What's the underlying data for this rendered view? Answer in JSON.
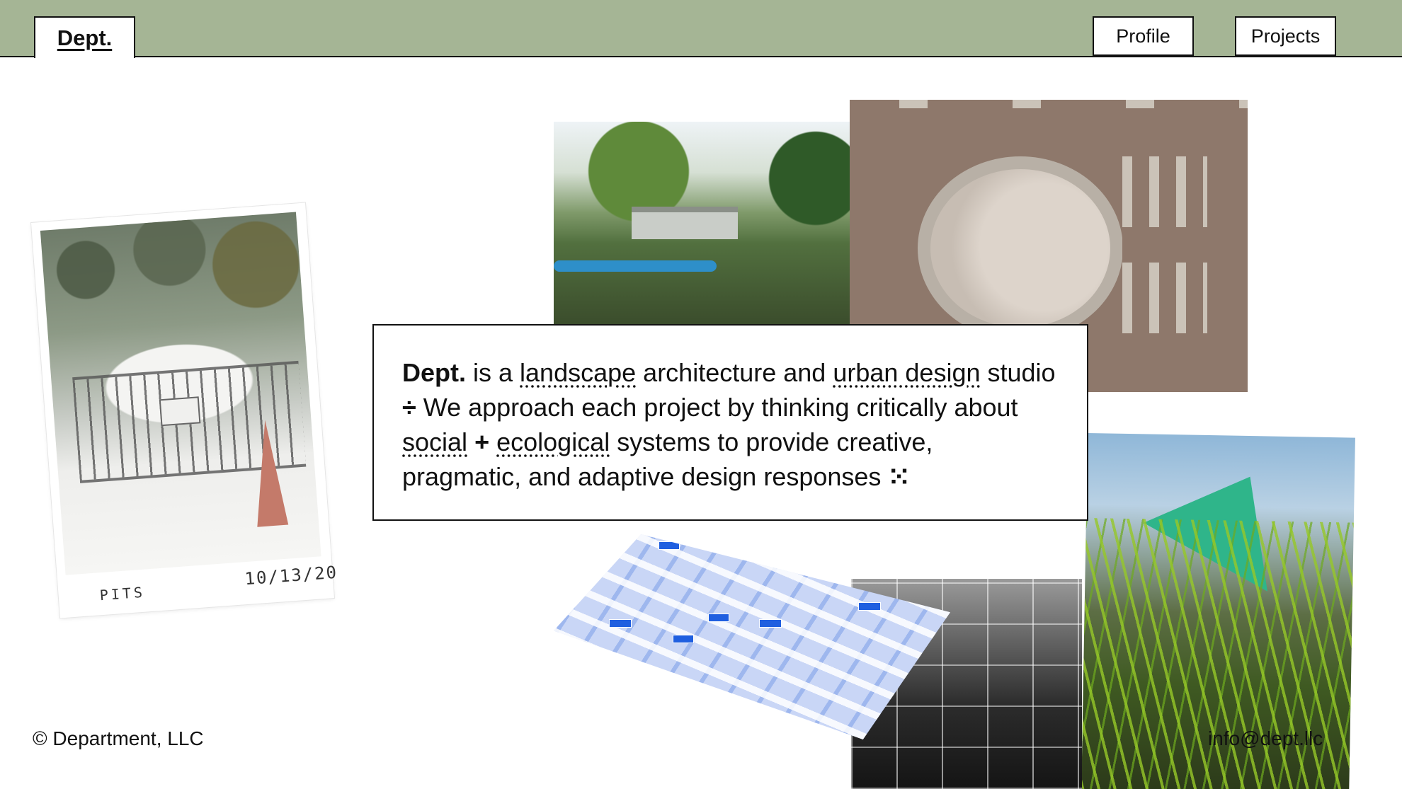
{
  "header": {
    "brand": "Dept.",
    "nav": [
      {
        "label": "Profile"
      },
      {
        "label": "Projects"
      }
    ]
  },
  "intro": {
    "brand": "Dept.",
    "t1": " is a ",
    "link_landscape": "landscape",
    "t2": " architecture and ",
    "link_urban": "urban design",
    "t3": " studio ",
    "glyph_divide": "÷",
    "t4": "  We approach each project by thinking critically about ",
    "link_social": "social",
    "t5": " ",
    "glyph_plus": "+",
    "t6": " ",
    "link_ecological": "ecological",
    "t7": " systems to provide creative, pragmatic, and adaptive design responses ",
    "glyph_end": "⁙"
  },
  "polaroid": {
    "caption_left": "PITS",
    "caption_right": "10/13/20"
  },
  "footer": {
    "copyright": "© Department, LLC",
    "email": "info@dept.llc"
  }
}
